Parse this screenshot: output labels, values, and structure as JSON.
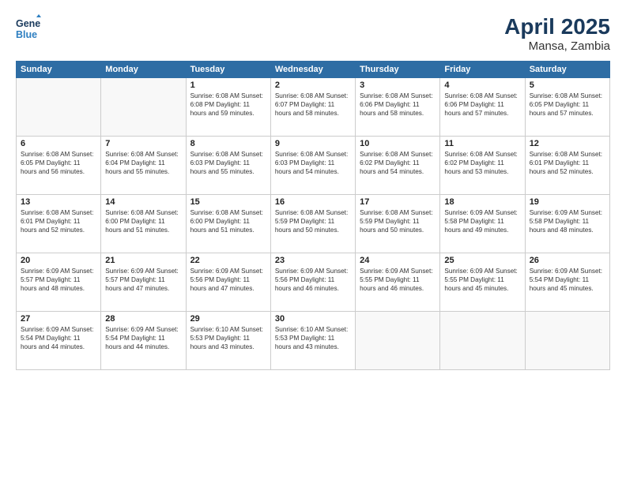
{
  "logo": {
    "line1": "General",
    "line2": "Blue"
  },
  "title": "April 2025",
  "subtitle": "Mansa, Zambia",
  "weekdays": [
    "Sunday",
    "Monday",
    "Tuesday",
    "Wednesday",
    "Thursday",
    "Friday",
    "Saturday"
  ],
  "weeks": [
    [
      {
        "day": "",
        "info": ""
      },
      {
        "day": "",
        "info": ""
      },
      {
        "day": "1",
        "info": "Sunrise: 6:08 AM\nSunset: 6:08 PM\nDaylight: 11 hours and 59 minutes."
      },
      {
        "day": "2",
        "info": "Sunrise: 6:08 AM\nSunset: 6:07 PM\nDaylight: 11 hours and 58 minutes."
      },
      {
        "day": "3",
        "info": "Sunrise: 6:08 AM\nSunset: 6:06 PM\nDaylight: 11 hours and 58 minutes."
      },
      {
        "day": "4",
        "info": "Sunrise: 6:08 AM\nSunset: 6:06 PM\nDaylight: 11 hours and 57 minutes."
      },
      {
        "day": "5",
        "info": "Sunrise: 6:08 AM\nSunset: 6:05 PM\nDaylight: 11 hours and 57 minutes."
      }
    ],
    [
      {
        "day": "6",
        "info": "Sunrise: 6:08 AM\nSunset: 6:05 PM\nDaylight: 11 hours and 56 minutes."
      },
      {
        "day": "7",
        "info": "Sunrise: 6:08 AM\nSunset: 6:04 PM\nDaylight: 11 hours and 55 minutes."
      },
      {
        "day": "8",
        "info": "Sunrise: 6:08 AM\nSunset: 6:03 PM\nDaylight: 11 hours and 55 minutes."
      },
      {
        "day": "9",
        "info": "Sunrise: 6:08 AM\nSunset: 6:03 PM\nDaylight: 11 hours and 54 minutes."
      },
      {
        "day": "10",
        "info": "Sunrise: 6:08 AM\nSunset: 6:02 PM\nDaylight: 11 hours and 54 minutes."
      },
      {
        "day": "11",
        "info": "Sunrise: 6:08 AM\nSunset: 6:02 PM\nDaylight: 11 hours and 53 minutes."
      },
      {
        "day": "12",
        "info": "Sunrise: 6:08 AM\nSunset: 6:01 PM\nDaylight: 11 hours and 52 minutes."
      }
    ],
    [
      {
        "day": "13",
        "info": "Sunrise: 6:08 AM\nSunset: 6:01 PM\nDaylight: 11 hours and 52 minutes."
      },
      {
        "day": "14",
        "info": "Sunrise: 6:08 AM\nSunset: 6:00 PM\nDaylight: 11 hours and 51 minutes."
      },
      {
        "day": "15",
        "info": "Sunrise: 6:08 AM\nSunset: 6:00 PM\nDaylight: 11 hours and 51 minutes."
      },
      {
        "day": "16",
        "info": "Sunrise: 6:08 AM\nSunset: 5:59 PM\nDaylight: 11 hours and 50 minutes."
      },
      {
        "day": "17",
        "info": "Sunrise: 6:08 AM\nSunset: 5:59 PM\nDaylight: 11 hours and 50 minutes."
      },
      {
        "day": "18",
        "info": "Sunrise: 6:09 AM\nSunset: 5:58 PM\nDaylight: 11 hours and 49 minutes."
      },
      {
        "day": "19",
        "info": "Sunrise: 6:09 AM\nSunset: 5:58 PM\nDaylight: 11 hours and 48 minutes."
      }
    ],
    [
      {
        "day": "20",
        "info": "Sunrise: 6:09 AM\nSunset: 5:57 PM\nDaylight: 11 hours and 48 minutes."
      },
      {
        "day": "21",
        "info": "Sunrise: 6:09 AM\nSunset: 5:57 PM\nDaylight: 11 hours and 47 minutes."
      },
      {
        "day": "22",
        "info": "Sunrise: 6:09 AM\nSunset: 5:56 PM\nDaylight: 11 hours and 47 minutes."
      },
      {
        "day": "23",
        "info": "Sunrise: 6:09 AM\nSunset: 5:56 PM\nDaylight: 11 hours and 46 minutes."
      },
      {
        "day": "24",
        "info": "Sunrise: 6:09 AM\nSunset: 5:55 PM\nDaylight: 11 hours and 46 minutes."
      },
      {
        "day": "25",
        "info": "Sunrise: 6:09 AM\nSunset: 5:55 PM\nDaylight: 11 hours and 45 minutes."
      },
      {
        "day": "26",
        "info": "Sunrise: 6:09 AM\nSunset: 5:54 PM\nDaylight: 11 hours and 45 minutes."
      }
    ],
    [
      {
        "day": "27",
        "info": "Sunrise: 6:09 AM\nSunset: 5:54 PM\nDaylight: 11 hours and 44 minutes."
      },
      {
        "day": "28",
        "info": "Sunrise: 6:09 AM\nSunset: 5:54 PM\nDaylight: 11 hours and 44 minutes."
      },
      {
        "day": "29",
        "info": "Sunrise: 6:10 AM\nSunset: 5:53 PM\nDaylight: 11 hours and 43 minutes."
      },
      {
        "day": "30",
        "info": "Sunrise: 6:10 AM\nSunset: 5:53 PM\nDaylight: 11 hours and 43 minutes."
      },
      {
        "day": "",
        "info": ""
      },
      {
        "day": "",
        "info": ""
      },
      {
        "day": "",
        "info": ""
      }
    ]
  ]
}
